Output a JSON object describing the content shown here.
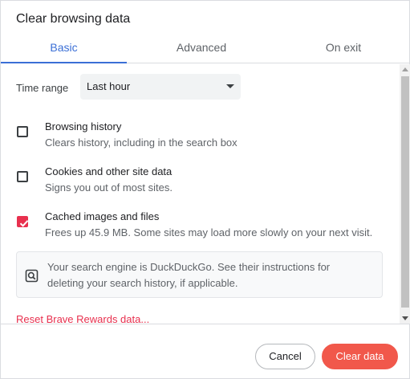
{
  "dialog": {
    "title": "Clear browsing data"
  },
  "tabs": [
    {
      "label": "Basic",
      "active": true
    },
    {
      "label": "Advanced",
      "active": false
    },
    {
      "label": "On exit",
      "active": false
    }
  ],
  "time_range": {
    "label": "Time range",
    "selected": "Last hour"
  },
  "options": [
    {
      "title": "Browsing history",
      "subtitle": "Clears history, including in the search box",
      "checked": false
    },
    {
      "title": "Cookies and other site data",
      "subtitle": "Signs you out of most sites.",
      "checked": false
    },
    {
      "title": "Cached images and files",
      "subtitle": "Frees up 45.9 MB. Some sites may load more slowly on your next visit.",
      "checked": true
    }
  ],
  "info": {
    "icon": "search-engine-icon",
    "line1": "Your search engine is DuckDuckGo. See their instructions for",
    "line2": "deleting your search history, if applicable."
  },
  "reset_link": "Reset Brave Rewards data...",
  "footer": {
    "cancel_label": "Cancel",
    "clear_label": "Clear data"
  },
  "colors": {
    "accent": "#3b6fd6",
    "brand": "#e8304e",
    "clear_button": "#f1584b"
  }
}
